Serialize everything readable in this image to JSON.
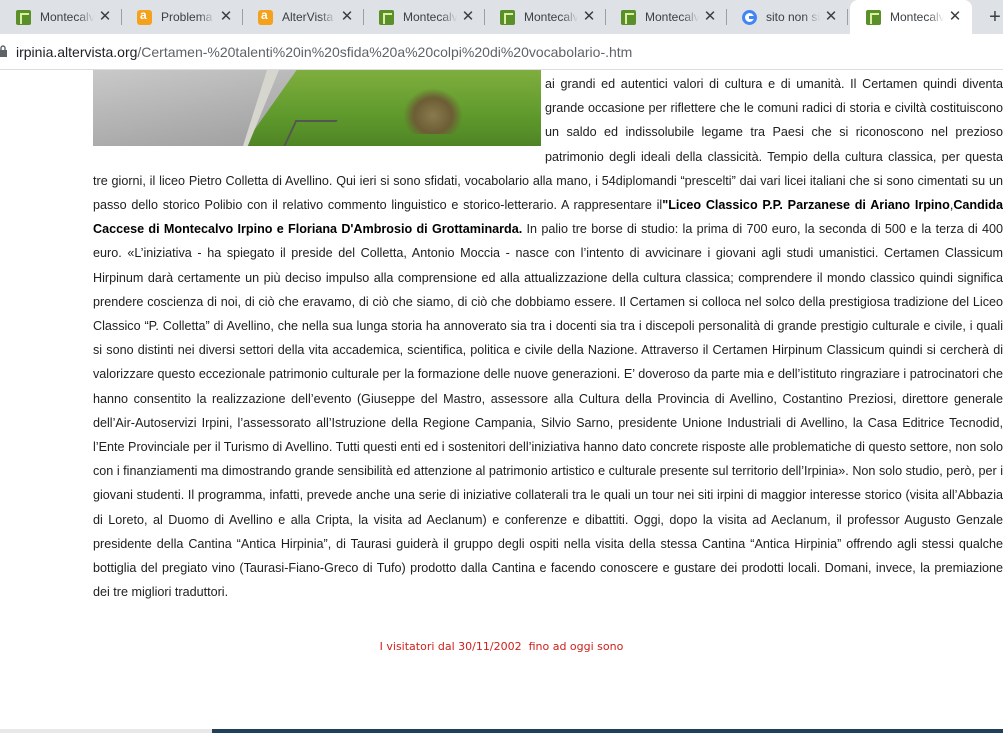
{
  "browser": {
    "tabs": [
      {
        "title": "Montecalvo Irpino",
        "icon": "montecalvo-favicon",
        "active": false
      },
      {
        "title": "Problema con",
        "icon": "altervista-favicon",
        "active": false
      },
      {
        "title": "AlterVista",
        "icon": "altervista-favicon",
        "active": false
      },
      {
        "title": "Montecalvo Irpino",
        "icon": "montecalvo-favicon",
        "active": false
      },
      {
        "title": "Montecalvo Irpino",
        "icon": "montecalvo-favicon",
        "active": false
      },
      {
        "title": "Montecalvo Irpino",
        "icon": "montecalvo-favicon",
        "active": false
      },
      {
        "title": "sito non si",
        "icon": "google-favicon",
        "active": false
      },
      {
        "title": "Montecalvo Irpino",
        "icon": "montecalvo-favicon",
        "active": true
      }
    ],
    "close_glyph": "✕",
    "new_tab_glyph": "+",
    "url_host": "irpinia.altervista.org",
    "url_path": "/Certamen-%20talenti%20in%20sfida%20a%20colpi%20di%20vocabolario-.htm"
  },
  "article": {
    "p1": "ai grandi ed autentici valori di cultura e di umanità. Il Certamen quindi diventa grande occasione per riflettere che le comuni radici di storia e civiltà costituiscono un saldo ed indissolubile legame tra Paesi che si riconoscono nel prezioso patrimonio degli ideali della classicità. Tempio della cultura classica, per questa tre giorni, il liceo Pietro Colletta di Avellino. Qui ieri si sono sfidati, vocabolario alla mano, i 54diplomandi “prescelti” dai vari licei italiani che si sono cimentati su un passo dello storico Polibio con il relativo commento linguistico e storico-letterario. A rappresentare il",
    "bold1": "\"Liceo Classico P.P. Parzanese di Ariano Irpino",
    "p2": ",",
    "bold2": "Candida Caccese di Montecalvo Irpino e Floriana D'Ambrosio di Grottaminarda.",
    "p3": " In palio tre borse di studio: la prima di 700 euro, la seconda di 500 e la terza di 400 euro. «L’iniziativa - ha spiegato il preside del Colletta, Antonio Moccia - nasce con l’intento di avvicinare i giovani agli studi umanistici. Certamen Classicum Hirpinum darà certamente un più deciso impulso alla comprensione ed alla attualizzazione della cultura classica; comprendere il mondo classico quindi significa prendere coscienza di noi, di ciò che eravamo, di ciò che siamo, di ciò che dobbiamo essere. Il Certamen si colloca nel solco della prestigiosa tradizione del Liceo Classico “P. Colletta” di Avellino, che nella sua lunga storia ha annoverato sia tra i docenti sia tra i discepoli personalità di grande prestigio culturale e civile, i quali si sono distinti nei diversi settori della vita accademica, scientifica, politica e civile della Nazione. Attraverso il Certamen Hirpinum Classicum quindi si cercherà di valorizzare questo eccezionale patrimonio culturale per la formazione delle nuove generazioni. E’ doveroso da parte mia e dell’istituto ringraziare i patrocinatori che hanno consentito la realizzazione dell’evento (Giuseppe del Mastro, assessore alla Cultura della Provincia di Avellino, Costantino Preziosi, direttore generale dell’Air-Autoservizi Irpini, l’assessorato all’Istruzione della Regione Campania, Silvio Sarno, presidente Unione Industriali di Avellino, la Casa Editrice Tecnodid, l’Ente Provinciale per il Turismo di Avellino. Tutti questi enti ed i sostenitori dell’iniziativa hanno dato concrete risposte alle problematiche di questo settore, non solo con i finanziamenti ma dimostrando grande sensibilità ed attenzione al patrimonio artistico e culturale presente sul territorio dell’Irpinia». Non solo studio, però, per i giovani studenti. Il programma, infatti, prevede anche una serie di iniziative collaterali tra le quali un tour nei siti irpini di maggior interesse storico (visita all’Abbazia di Loreto, al Duomo di Avellino e alla Cripta, la visita ad Aeclanum) e conferenze e dibattiti. Oggi, dopo la visita ad Aeclanum, il professor Augusto Genzale presidente della Cantina “Antica Hirpinia”, di Taurasi guiderà il gruppo degli ospiti nella visita della stessa Cantina “Antica Hirpinia” offrendo agli stessi qualche bottiglia del pregiato vino (Taurasi-Fiano-Greco di Tufo) prodotto dalla Cantina e facendo conoscere e gustare dei prodotti locali. Domani, invece, la premiazione dei tre migliori traduttori."
  },
  "counter_text": "I visitatori dal 30/11/2002  fino ad oggi sono",
  "colors": {
    "tabstrip_bg": "#dee1e6",
    "counter_red": "#d0201a",
    "text": "#202020"
  }
}
